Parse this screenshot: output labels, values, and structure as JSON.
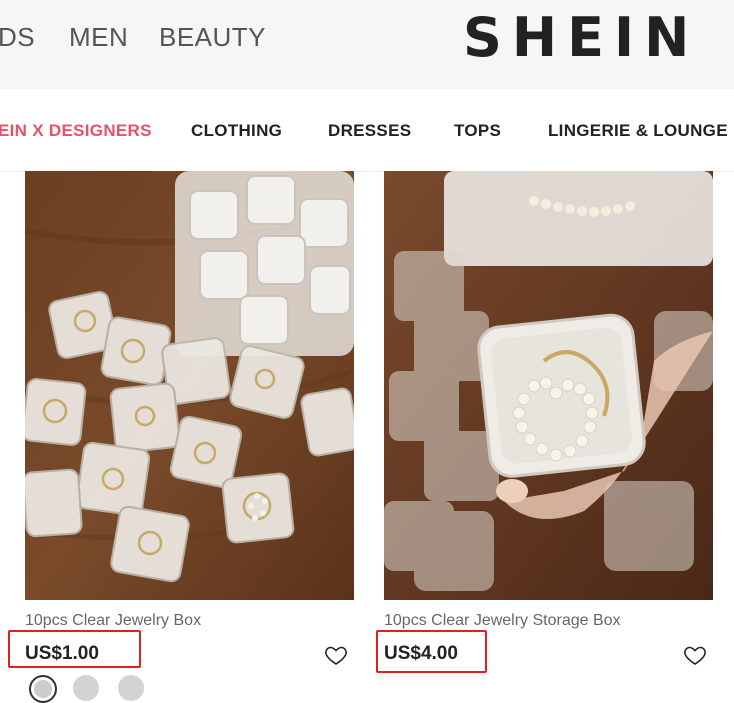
{
  "header": {
    "nav": [
      "DS",
      "MEN",
      "BEAUTY"
    ],
    "logo": "SHEIN"
  },
  "categories": [
    "EIN X DESIGNERS",
    "CLOTHING",
    "DRESSES",
    "TOPS",
    "LINGERIE & LOUNGE"
  ],
  "products": [
    {
      "title": "10pcs Clear Jewelry Box",
      "price": "US$1.00",
      "swatch_count": 3
    },
    {
      "title": "10pcs Clear Jewelry Storage Box",
      "price": "US$4.00"
    }
  ],
  "colors": {
    "highlight": "#e8516b",
    "annotation_box": "#e0201d"
  }
}
